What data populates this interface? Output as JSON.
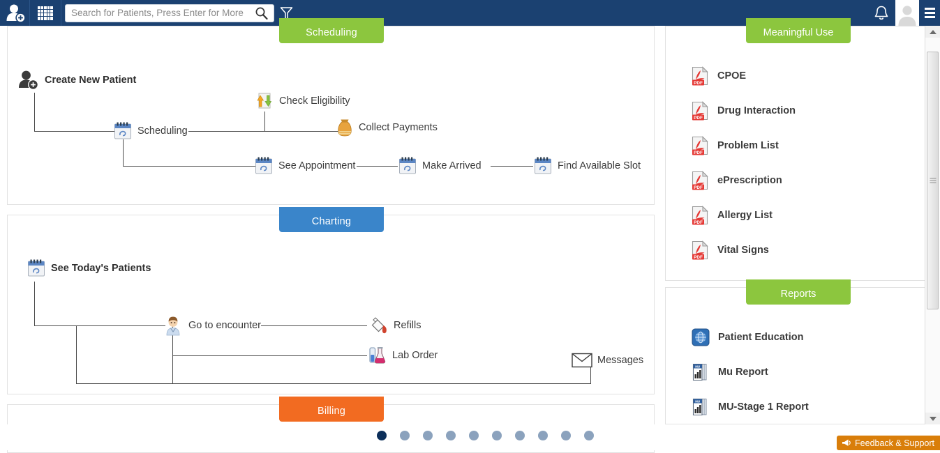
{
  "topbar": {
    "add_patient_icon": "add-user-icon",
    "apps_icon": "grid-apps-icon",
    "search": {
      "placeholder": "Search for Patients, Press Enter for More",
      "value": "",
      "icon": "search-icon"
    },
    "filter_icon": "funnel-filter-icon",
    "notifications_icon": "bell-icon",
    "avatar_icon": "user-avatar-icon",
    "menu_icon": "hamburger-menu-icon",
    "background_color": "#1b4171"
  },
  "workflow": {
    "sections": [
      {
        "title": "Scheduling",
        "color": "#8cc63e",
        "nodes": [
          {
            "label": "Create New Patient",
            "icon": "add-user-icon"
          },
          {
            "label": "Scheduling",
            "icon": "calendar-icon"
          },
          {
            "label": "Check Eligibility",
            "icon": "document-exchange-icon"
          },
          {
            "label": "Collect Payments",
            "icon": "money-bag-icon"
          },
          {
            "label": "See Appointment",
            "icon": "calendar-icon"
          },
          {
            "label": "Make Arrived",
            "icon": "calendar-icon"
          },
          {
            "label": "Find Available Slot",
            "icon": "calendar-icon"
          }
        ]
      },
      {
        "title": "Charting",
        "color": "#3a85ca",
        "nodes": [
          {
            "label": "See Today's Patients",
            "icon": "calendar-icon"
          },
          {
            "label": "Go to encounter",
            "icon": "doctor-icon"
          },
          {
            "label": "Refills",
            "icon": "pill-refill-icon"
          },
          {
            "label": "Lab Order",
            "icon": "lab-flask-icon"
          },
          {
            "label": "Messages",
            "icon": "envelope-icon"
          }
        ]
      },
      {
        "title": "Billing",
        "color": "#f26b21",
        "nodes": []
      }
    ]
  },
  "panels": [
    {
      "title": "Meaningful Use",
      "color": "#8cc63e",
      "items": [
        {
          "label": "CPOE",
          "icon": "pdf-icon"
        },
        {
          "label": "Drug Interaction",
          "icon": "pdf-icon"
        },
        {
          "label": "Problem List",
          "icon": "pdf-icon"
        },
        {
          "label": "ePrescription",
          "icon": "pdf-icon"
        },
        {
          "label": "Allergy List",
          "icon": "pdf-icon"
        },
        {
          "label": "Vital Signs",
          "icon": "pdf-icon"
        }
      ]
    },
    {
      "title": "Reports",
      "color": "#8cc63e",
      "items": [
        {
          "label": "Patient Education",
          "icon": "globe-icon"
        },
        {
          "label": "Mu Report",
          "icon": "report-chart-icon"
        },
        {
          "label": "MU-Stage 1 Report",
          "icon": "report-chart-icon"
        }
      ]
    }
  ],
  "pagination": {
    "total": 10,
    "active_index": 0,
    "active_color": "#0c2f5a",
    "inactive_color": "#8ba2bd"
  },
  "feedback": {
    "label": "Feedback & Support",
    "icon": "megaphone-icon",
    "color": "#d97e0a"
  },
  "scrollbar": {
    "up_icon": "scroll-up-arrow-icon",
    "down_icon": "scroll-down-arrow-icon"
  }
}
